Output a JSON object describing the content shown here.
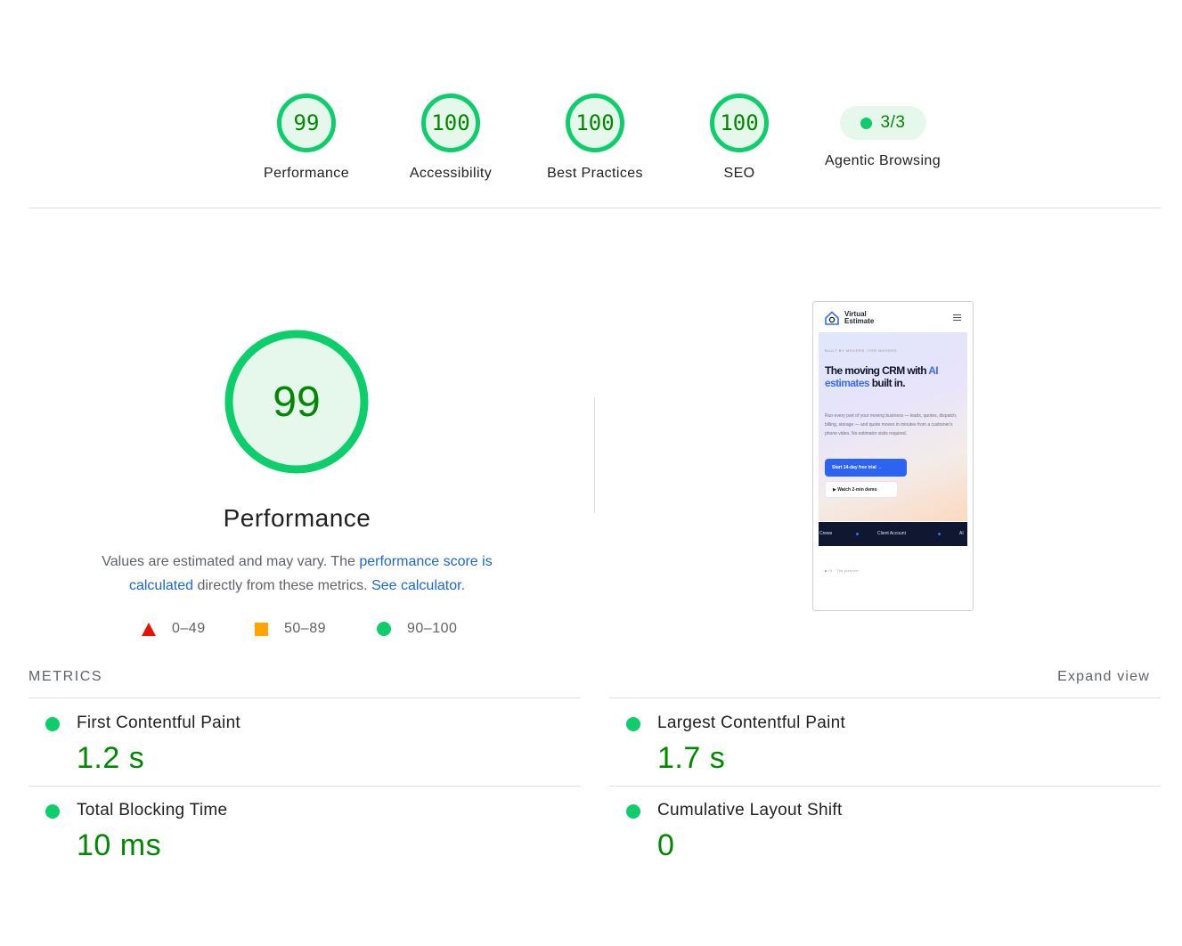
{
  "colors": {
    "pass": "#0cce6b",
    "pass_text": "#008800",
    "pass_fill": "#e6f8ec",
    "average": "#ffa400",
    "fail": "#eb0f00",
    "link": "#1a66d9"
  },
  "scores": [
    {
      "value": "99",
      "label": "Performance"
    },
    {
      "value": "100",
      "label": "Accessibility"
    },
    {
      "value": "100",
      "label": "Best Practices"
    },
    {
      "value": "100",
      "label": "SEO"
    }
  ],
  "agentic": {
    "value": "3/3",
    "label": "Agentic Browsing"
  },
  "performance": {
    "score": "99",
    "title": "Performance",
    "desc_prefix": "Values are estimated and may vary. The ",
    "desc_link": "performance score is calculated",
    "desc_middle": " directly from these metrics. ",
    "desc_calc": "See calculator.",
    "legend": {
      "fail": "0–49",
      "average": "50–89",
      "pass": "90–100"
    }
  },
  "preview": {
    "brand_line1": "Virtual",
    "brand_line2": "Estimate",
    "kicker": "BUILT BY MOVERS, FOR MOVERS",
    "headline_a": "The moving CRM with ",
    "headline_accent": "AI estimates",
    "headline_b": " built in.",
    "body": "Run every part of your moving business — leads, quotes, dispatch, billing, storage — and quote moves in minutes from a customer's phone video. No estimator visits required.",
    "cta_primary": "Start 14-day free trial →",
    "cta_secondary": "▶ Watch 2-min demo",
    "band_item1": "Crews",
    "band_item2": "Client Account",
    "band_item3": "AI",
    "footer": "▶ 01 · The platform"
  },
  "metrics": {
    "heading": "METRICS",
    "expand": "Expand view",
    "items": [
      {
        "name": "First Contentful Paint",
        "value": "1.2 s"
      },
      {
        "name": "Largest Contentful Paint",
        "value": "1.7 s"
      },
      {
        "name": "Total Blocking Time",
        "value": "10 ms"
      },
      {
        "name": "Cumulative Layout Shift",
        "value": "0"
      }
    ]
  }
}
